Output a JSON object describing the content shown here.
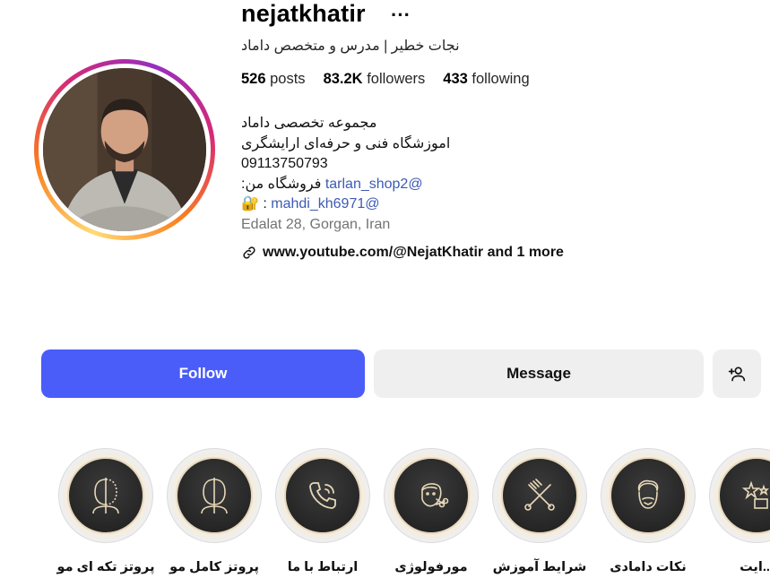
{
  "profile": {
    "username": "nejatkhatir",
    "full_name": "نجات خطیر | مدرس و متخصص داماد",
    "stats": {
      "posts_num": "526",
      "posts_label": "posts",
      "followers_num": "83.2K",
      "followers_label": "followers",
      "following_num": "433",
      "following_label": "following"
    },
    "bio": {
      "line1": "مجموعه تخصصی داماد",
      "line2": "اموزشگاه فنی و حرفه‌ای ارایشگری",
      "line3": "09113750793",
      "line4_prefix": "فروشگاه من:",
      "line4_link": "tarlan_shop2@",
      "line5_prefix": "🔐 :",
      "line5_link": "mahdi_kh6971@",
      "location": "Edalat 28, Gorgan, Iran"
    },
    "external_link": "www.youtube.com/@NejatKhatir and 1 more"
  },
  "actions": {
    "follow_label": "Follow",
    "message_label": "Message"
  },
  "highlights": [
    {
      "label": "پروتز تکه ای مو",
      "icon": "half-face-icon"
    },
    {
      "label": "پروتز کامل مو",
      "icon": "half-face-icon"
    },
    {
      "label": "ارتباط با ما",
      "icon": "phone-icon"
    },
    {
      "label": "مورفولوژی",
      "icon": "face-scissors-icon"
    },
    {
      "label": "شرایط آموزش",
      "icon": "comb-scissors-icon"
    },
    {
      "label": "نکات دامادی",
      "icon": "bearded-man-icon"
    },
    {
      "label": "...ایت",
      "icon": "stars-icon"
    }
  ],
  "colors": {
    "follow_button": "#4a5df9",
    "secondary_button": "#efefef",
    "link": "#3d5ab3"
  }
}
